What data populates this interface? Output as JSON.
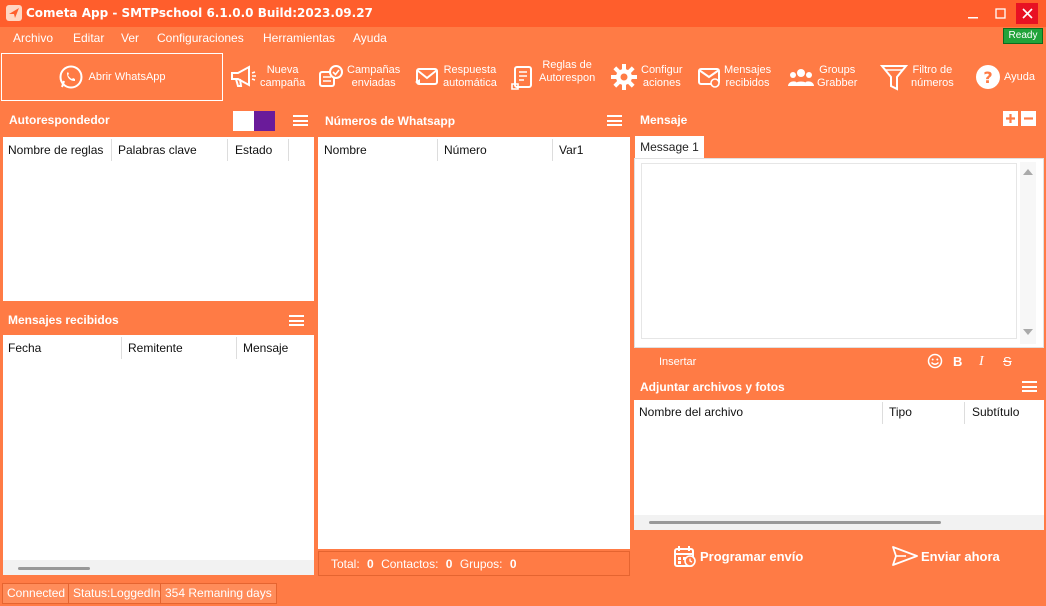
{
  "window": {
    "title": "Cometa App - SMTPschool 6.1.0.0 Build:2023.09.27",
    "minimize_icon": "minimize-icon",
    "maximize_icon": "maximize-icon",
    "close_icon": "close-icon"
  },
  "menu": {
    "items": [
      "Archivo",
      "Editar",
      "Ver",
      "Configuraciones",
      "Herramientas",
      "Ayuda"
    ],
    "ready_badge": "Ready"
  },
  "toolbar": {
    "open_whatsapp": "Abrir WhatsApp",
    "new_campaign": [
      "Nueva",
      "campaña"
    ],
    "sent_campaigns": [
      "Campañas",
      "enviadas"
    ],
    "auto_reply": [
      "Respuesta",
      "automática"
    ],
    "autoresponder_rules": [
      "Reglas de",
      "Autorespon"
    ],
    "settings": [
      "Configur",
      "aciones"
    ],
    "received_messages": [
      "Mensajes",
      "recibidos"
    ],
    "groups_grabber": [
      "Groups",
      "Grabber"
    ],
    "number_filter": [
      "Filtro de",
      "números"
    ],
    "help": "Ayuda"
  },
  "autoresponder": {
    "title": "Autorespondedor",
    "columns": [
      "Nombre de reglas",
      "Palabras clave",
      "Estado"
    ],
    "toggle_colors": [
      "#FFFFFF",
      "#6A1B9A"
    ]
  },
  "received": {
    "title": "Mensajes recibidos",
    "columns": [
      "Fecha",
      "Remitente",
      "Mensaje"
    ]
  },
  "numbers": {
    "title": "Números de Whatsapp",
    "columns": [
      "Nombre",
      "Número",
      "Var1"
    ],
    "footer": {
      "total_label": "Total:",
      "total_value": "0",
      "contacts_label": "Contactos:",
      "contacts_value": "0",
      "groups_label": "Grupos:",
      "groups_value": "0"
    }
  },
  "message": {
    "title": "Mensaje",
    "tab": "Message 1",
    "body": "",
    "insert_label": "Insertar",
    "format_bold": "B",
    "format_italic": "I",
    "format_strike": "S"
  },
  "attachments": {
    "title": "Adjuntar archivos y fotos",
    "columns": [
      "Nombre del archivo",
      "Tipo",
      "Subtítulo"
    ]
  },
  "actions": {
    "schedule": "Programar envío",
    "send_now": "Enviar ahora"
  },
  "status": {
    "connection": "Connected",
    "login": "Status:LoggedIn",
    "remaining": "354 Remaning days"
  },
  "colors": {
    "accent": "#FF7B45",
    "title_bar": "#FF5E2C",
    "close_button": "#E81123",
    "ready_badge": "#21A33A"
  }
}
